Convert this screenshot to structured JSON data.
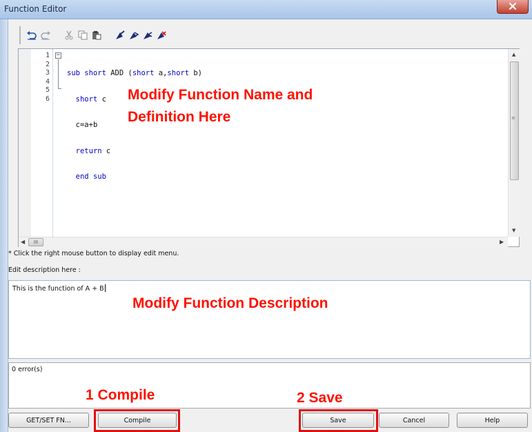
{
  "window": {
    "title": "Function Editor",
    "close_glyph": "X"
  },
  "toolbar": {
    "icons": [
      "undo-icon",
      "redo-icon",
      "cut-icon",
      "copy-icon",
      "paste-icon",
      "bookmark-icon",
      "bookmark-next-icon",
      "bookmark-prev-icon",
      "bookmark-clear-icon"
    ]
  },
  "editor": {
    "line_numbers": [
      "1",
      "2",
      "3",
      "4",
      "5",
      "6"
    ],
    "lines": [
      {
        "kw1": "sub short",
        "text": " ADD (",
        "kw2": "short",
        "text2": " a,",
        "kw3": "short",
        "text3": " b)"
      },
      {
        "indent": "  ",
        "kw1": "short",
        "text": " c"
      },
      {
        "indent": "  ",
        "text": "c=a+b"
      },
      {
        "indent": "  ",
        "kw1": "return",
        "text": " c"
      },
      {
        "indent": "  ",
        "kw1": "end sub",
        "text": ""
      },
      {
        "text": ""
      }
    ],
    "hscroll_grip": "III"
  },
  "annotations": {
    "name_line1": "Modify Function Name and",
    "name_line2": "Definition Here",
    "description": "Modify Function Description",
    "compile": "1  Compile",
    "save": "2  Save"
  },
  "hint": "* Click the right mouse button to display edit menu.",
  "description": {
    "label": "Edit description here :",
    "value": "This is the function of A + B"
  },
  "errors": {
    "text": "0 error(s)"
  },
  "buttons": {
    "get_set": "GET/SET FN...",
    "compile": "Compile",
    "save": "Save",
    "cancel": "Cancel",
    "help": "Help"
  },
  "colors": {
    "keyword": "#0000c8",
    "annotation": "#ff1200",
    "highlight": "#e01010"
  }
}
